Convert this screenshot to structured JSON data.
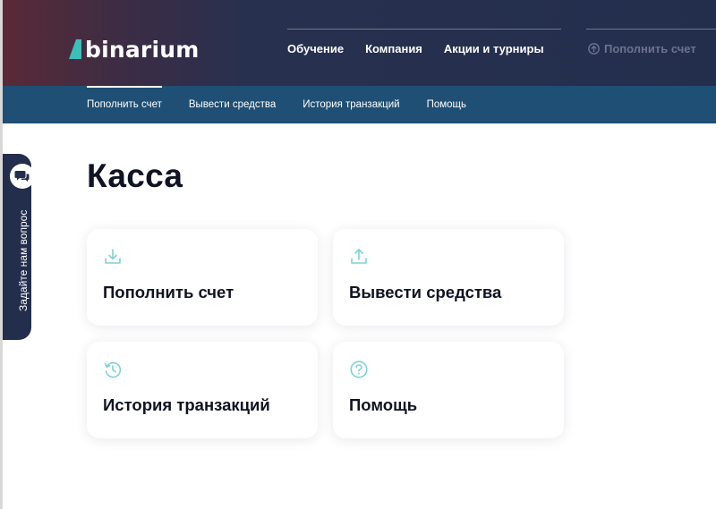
{
  "brand": {
    "name": "binarium",
    "accent": "#3bbfb8"
  },
  "topnav": {
    "items": [
      {
        "label": "Обучение"
      },
      {
        "label": "Компания"
      },
      {
        "label": "Акции и турниры"
      }
    ],
    "deposit_label": "Пополнить счет"
  },
  "subnav": {
    "items": [
      {
        "label": "Пополнить счет",
        "active": true
      },
      {
        "label": "Вывести средства"
      },
      {
        "label": "История транзакций"
      },
      {
        "label": "Помощь"
      }
    ]
  },
  "sidetab": {
    "label": "Задайте нам вопрос",
    "icon": "chat-bubbles-icon"
  },
  "main": {
    "title": "Касса",
    "cards": [
      {
        "label": "Пополнить счет",
        "icon": "download-icon"
      },
      {
        "label": "Вывести средства",
        "icon": "upload-icon"
      },
      {
        "label": "История транзакций",
        "icon": "history-icon"
      },
      {
        "label": "Помощь",
        "icon": "help-icon"
      }
    ]
  },
  "colors": {
    "header_bg": "#232e4d",
    "subnav_bg": "#1f4f74",
    "icon_teal": "#7fd3d3",
    "text_dark": "#0f1322"
  }
}
